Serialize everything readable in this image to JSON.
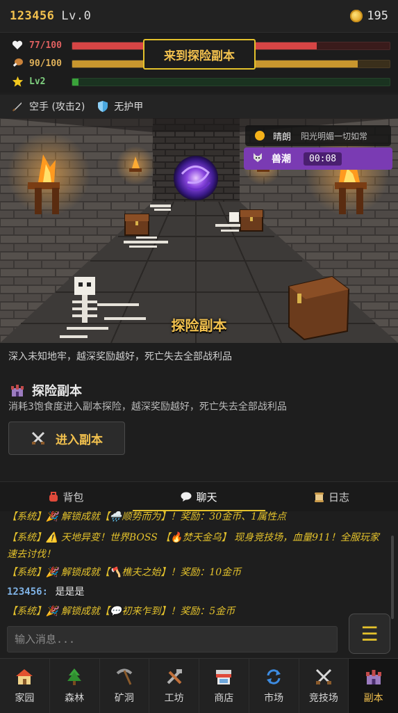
{
  "player": {
    "id": "123456",
    "level": "Lv.0",
    "coins": "195"
  },
  "stats": {
    "hp": {
      "text": "77/100",
      "fraction": 0.77,
      "color": "#d64545"
    },
    "food": {
      "text": "90/100",
      "fraction": 0.9,
      "color": "#c8962e"
    },
    "exp": {
      "text": "Lv2",
      "fraction": 0.02,
      "color": "#3aa33a"
    }
  },
  "toast": "来到探险副本",
  "equipment": {
    "weapon": "空手 (攻击2)",
    "armor": "无护甲"
  },
  "scene": {
    "title": "探险副本"
  },
  "weather": {
    "name": "晴朗",
    "desc": "阳光明媚一切如常"
  },
  "event": {
    "name": "兽潮",
    "timer": "00:08"
  },
  "description": "深入未知地牢，越深奖励越好，死亡失去全部战利品",
  "section": {
    "title": "探险副本",
    "subtitle": "消耗3饱食度进入副本探险，越深奖励越好，死亡失去全部战利品",
    "enter_label": "进入副本"
  },
  "tabs": [
    {
      "label": "背包",
      "icon": "backpack-icon"
    },
    {
      "label": "聊天",
      "icon": "chat-bubble-icon"
    },
    {
      "label": "日志",
      "icon": "scroll-icon"
    }
  ],
  "chat": [
    {
      "text": "【系统】🎉 解锁成就【🌧️顺势而为】！奖励：30金币、1属性点"
    },
    {
      "text": "【系统】⚠️ 天地异变！世界BOSS 【🔥焚天金乌】 现身竞技场，血量911！全服玩家速去讨伐！"
    },
    {
      "text": "【系统】🎉 解锁成就【🪓樵夫之始】！奖励：10金币"
    },
    {
      "name": "123456:",
      "text": "是是是"
    },
    {
      "text": "【系统】🎉 解锁成就【💬初来乍到】！奖励：5金币"
    }
  ],
  "input": {
    "placeholder": "输入消息..."
  },
  "menu_label": "☰",
  "nav": [
    {
      "label": "家园",
      "icon": "house-icon"
    },
    {
      "label": "森林",
      "icon": "tree-icon"
    },
    {
      "label": "矿洞",
      "icon": "pickaxe-icon"
    },
    {
      "label": "工坊",
      "icon": "tools-icon"
    },
    {
      "label": "商店",
      "icon": "shop-icon"
    },
    {
      "label": "市场",
      "icon": "exchange-icon"
    },
    {
      "label": "竞技场",
      "icon": "crossed-swords-icon"
    },
    {
      "label": "副本",
      "icon": "castle-icon"
    }
  ]
}
